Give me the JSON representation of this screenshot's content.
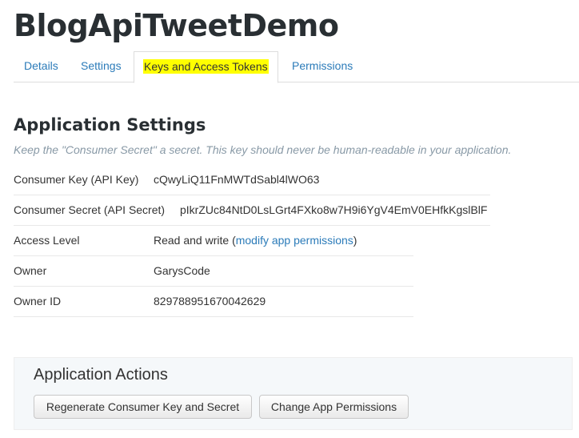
{
  "app": {
    "title": "BlogApiTweetDemo"
  },
  "tabs": [
    {
      "label": "Details"
    },
    {
      "label": "Settings"
    },
    {
      "label": "Keys and Access Tokens"
    },
    {
      "label": "Permissions"
    }
  ],
  "app_settings": {
    "title": "Application Settings",
    "note": "Keep the \"Consumer Secret\" a secret. This key should never be human-readable in your application.",
    "rows": [
      {
        "label": "Consumer Key (API Key)",
        "value": "cQwyLiQ11FnMWTdSabl4lWO63"
      },
      {
        "label": "Consumer Secret (API Secret)",
        "value": "pIkrZUc84NtD0LsLGrt4FXko8w7H9i6YgV4EmV0EHfkKgslBlF"
      },
      {
        "label": "Access Level",
        "value": "Read and write",
        "link_open": "(",
        "link_text": "modify app permissions",
        "link_close": ")"
      },
      {
        "label": "Owner",
        "value": "GarysCode"
      },
      {
        "label": "Owner ID",
        "value": "829788951670042629"
      }
    ]
  },
  "app_actions": {
    "title": "Application Actions",
    "regenerate_label": "Regenerate Consumer Key and Secret",
    "change_permissions_label": "Change App Permissions"
  },
  "colors": {
    "link": "#2b7bb9",
    "highlight": "#ffff00",
    "panel_bg": "#f5f8fa"
  }
}
